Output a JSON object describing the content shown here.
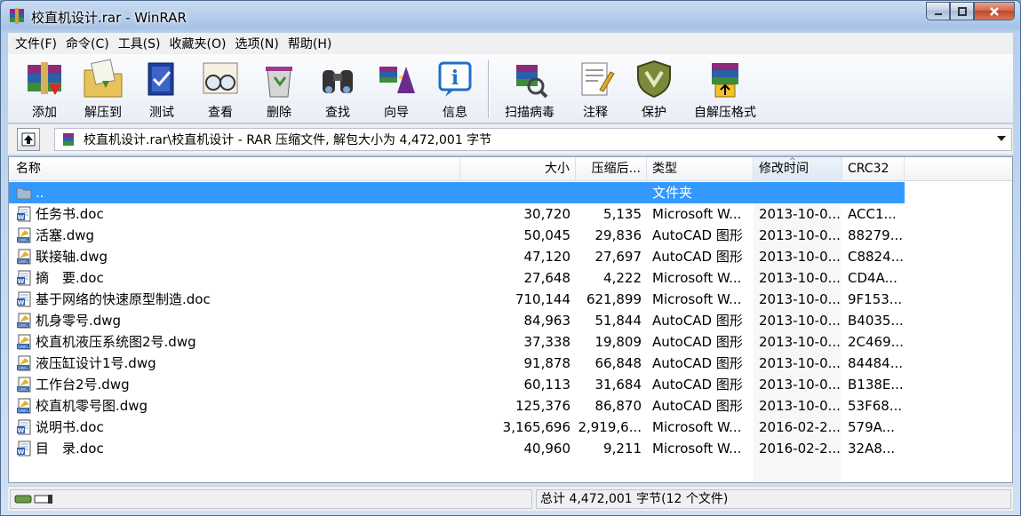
{
  "window": {
    "title": "校直机设计.rar - WinRAR"
  },
  "menu": [
    "文件(F)",
    "命令(C)",
    "工具(S)",
    "收藏夹(O)",
    "选项(N)",
    "帮助(H)"
  ],
  "toolbar": {
    "add": "添加",
    "extract": "解压到",
    "test": "测试",
    "view": "查看",
    "delete": "删除",
    "find": "查找",
    "wizard": "向导",
    "info": "信息",
    "virus": "扫描病毒",
    "comment": "注释",
    "protect": "保护",
    "sfx": "自解压格式"
  },
  "address": {
    "path": "校直机设计.rar\\校直机设计 - RAR 压缩文件, 解包大小为 4,472,001 字节"
  },
  "columns": {
    "name": "名称",
    "size": "大小",
    "packed": "压缩后...",
    "type": "类型",
    "modified": "修改时间",
    "crc": "CRC32"
  },
  "parent_row": {
    "name": "..",
    "type": "文件夹"
  },
  "files": [
    {
      "name": "任务书.doc",
      "size": "30,720",
      "packed": "5,135",
      "type": "Microsoft W...",
      "modified": "2013-10-0...",
      "crc": "ACC1...",
      "kind": "doc"
    },
    {
      "name": "活塞.dwg",
      "size": "50,045",
      "packed": "29,836",
      "type": "AutoCAD 图形",
      "modified": "2013-10-0...",
      "crc": "88279...",
      "kind": "dwg"
    },
    {
      "name": "联接轴.dwg",
      "size": "47,120",
      "packed": "27,697",
      "type": "AutoCAD 图形",
      "modified": "2013-10-0...",
      "crc": "C8824...",
      "kind": "dwg"
    },
    {
      "name": "摘　要.doc",
      "size": "27,648",
      "packed": "4,222",
      "type": "Microsoft W...",
      "modified": "2013-10-0...",
      "crc": "CD4A...",
      "kind": "doc"
    },
    {
      "name": "基于网络的快速原型制造.doc",
      "size": "710,144",
      "packed": "621,899",
      "type": "Microsoft W...",
      "modified": "2013-10-0...",
      "crc": "9F153...",
      "kind": "doc"
    },
    {
      "name": "机身零号.dwg",
      "size": "84,963",
      "packed": "51,844",
      "type": "AutoCAD 图形",
      "modified": "2013-10-0...",
      "crc": "B4035...",
      "kind": "dwg"
    },
    {
      "name": "校直机液压系统图2号.dwg",
      "size": "37,338",
      "packed": "19,809",
      "type": "AutoCAD 图形",
      "modified": "2013-10-0...",
      "crc": "2C469...",
      "kind": "dwg"
    },
    {
      "name": "液压缸设计1号.dwg",
      "size": "91,878",
      "packed": "66,848",
      "type": "AutoCAD 图形",
      "modified": "2013-10-0...",
      "crc": "84484...",
      "kind": "dwg"
    },
    {
      "name": "工作台2号.dwg",
      "size": "60,113",
      "packed": "31,684",
      "type": "AutoCAD 图形",
      "modified": "2013-10-0...",
      "crc": "B138E...",
      "kind": "dwg"
    },
    {
      "name": "校直机零号图.dwg",
      "size": "125,376",
      "packed": "86,870",
      "type": "AutoCAD 图形",
      "modified": "2013-10-0...",
      "crc": "53F68...",
      "kind": "dwg"
    },
    {
      "name": "说明书.doc",
      "size": "3,165,696",
      "packed": "2,919,6...",
      "type": "Microsoft W...",
      "modified": "2016-02-2...",
      "crc": "579A...",
      "kind": "doc"
    },
    {
      "name": "目　录.doc",
      "size": "40,960",
      "packed": "9,211",
      "type": "Microsoft W...",
      "modified": "2016-02-2...",
      "crc": "32A8...",
      "kind": "doc"
    }
  ],
  "status": {
    "summary": "总计 4,472,001 字节(12 个文件)"
  },
  "icons": {
    "app": "winrar-books-icon",
    "up": "up-folder-icon",
    "doc": "word-document-icon",
    "dwg": "autocad-drawing-icon",
    "folder": "folder-icon"
  },
  "colors": {
    "selection": "#3399ff",
    "close": "#c1452a"
  }
}
